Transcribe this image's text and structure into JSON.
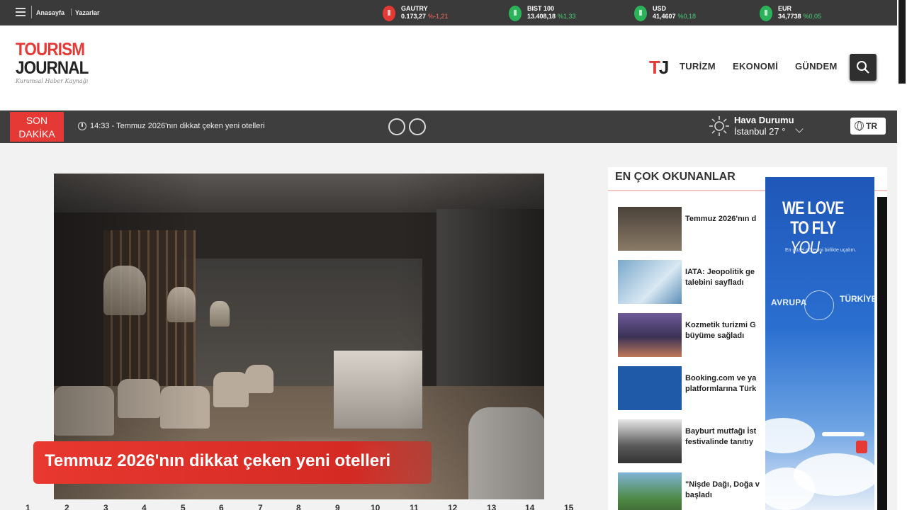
{
  "topbar": {
    "links": [
      "Anasayfa",
      "Yazarlar"
    ],
    "tickers": [
      {
        "name": "GAUTRY",
        "value": "0.173,27",
        "change": "%-1,21",
        "direction": "down"
      },
      {
        "name": "BIST 100",
        "value": "13.408,18",
        "change": "%1,33",
        "direction": "up"
      },
      {
        "name": "USD",
        "value": "41,4607",
        "change": "%0,18",
        "direction": "up"
      },
      {
        "name": "EUR",
        "value": "34,7738",
        "change": "%0,05",
        "direction": "up"
      }
    ]
  },
  "header": {
    "logo_line1": "TOURISM",
    "logo_line2": "JOURNAL",
    "logo_tagline": "Kurumsal Haber Kaynağı",
    "tj_t": "T",
    "tj_j": "J",
    "nav": [
      "TURİZM",
      "EKONOMİ",
      "GÜNDEM"
    ]
  },
  "breaking": {
    "label_line1": "SON",
    "label_line2": "DAKİKA",
    "text": "14:33 - Temmuz 2026'nın dikkat çeken yeni otelleri"
  },
  "weather": {
    "title": "Hava Durumu",
    "location": "İstanbul 27 °"
  },
  "language": "TR",
  "hero": {
    "caption": "Temmuz 2026'nın dikkat çeken yeni otelleri"
  },
  "pagination": [
    "1",
    "2",
    "3",
    "4",
    "5",
    "6",
    "7",
    "8",
    "9",
    "10",
    "11",
    "12",
    "13",
    "14",
    "15"
  ],
  "sidebar": {
    "title": "EN ÇOK OKUNANLAR",
    "items": [
      {
        "line1": "Temmuz 2026'nın d",
        "line2": ""
      },
      {
        "line1": "IATA: Jeopolitik ge",
        "line2": "talebini sayfladı"
      },
      {
        "line1": "Kozmetik turizmi G",
        "line2": "büyüme sağladı"
      },
      {
        "line1": "Booking.com ve ya",
        "line2": "platformlarına Türk"
      },
      {
        "line1": "Bayburt mutfağı İst",
        "line2": "festivalinde tanıtıy"
      },
      {
        "line1": "\"Nişde Dağı, Doğa v",
        "line2": "başladı"
      }
    ]
  },
  "ad": {
    "headline1": "WE LOVE",
    "headline2": "TO FLY",
    "headline3": "YOU.",
    "sub": "En güzel görevini birlikte uçalım.",
    "left_word": "AVRUPA",
    "right_word": "TÜRKİYE",
    "brand_color": "#1f57b8"
  },
  "colors": {
    "accent": "#e53935",
    "dark_bar": "#3a3a3a"
  }
}
